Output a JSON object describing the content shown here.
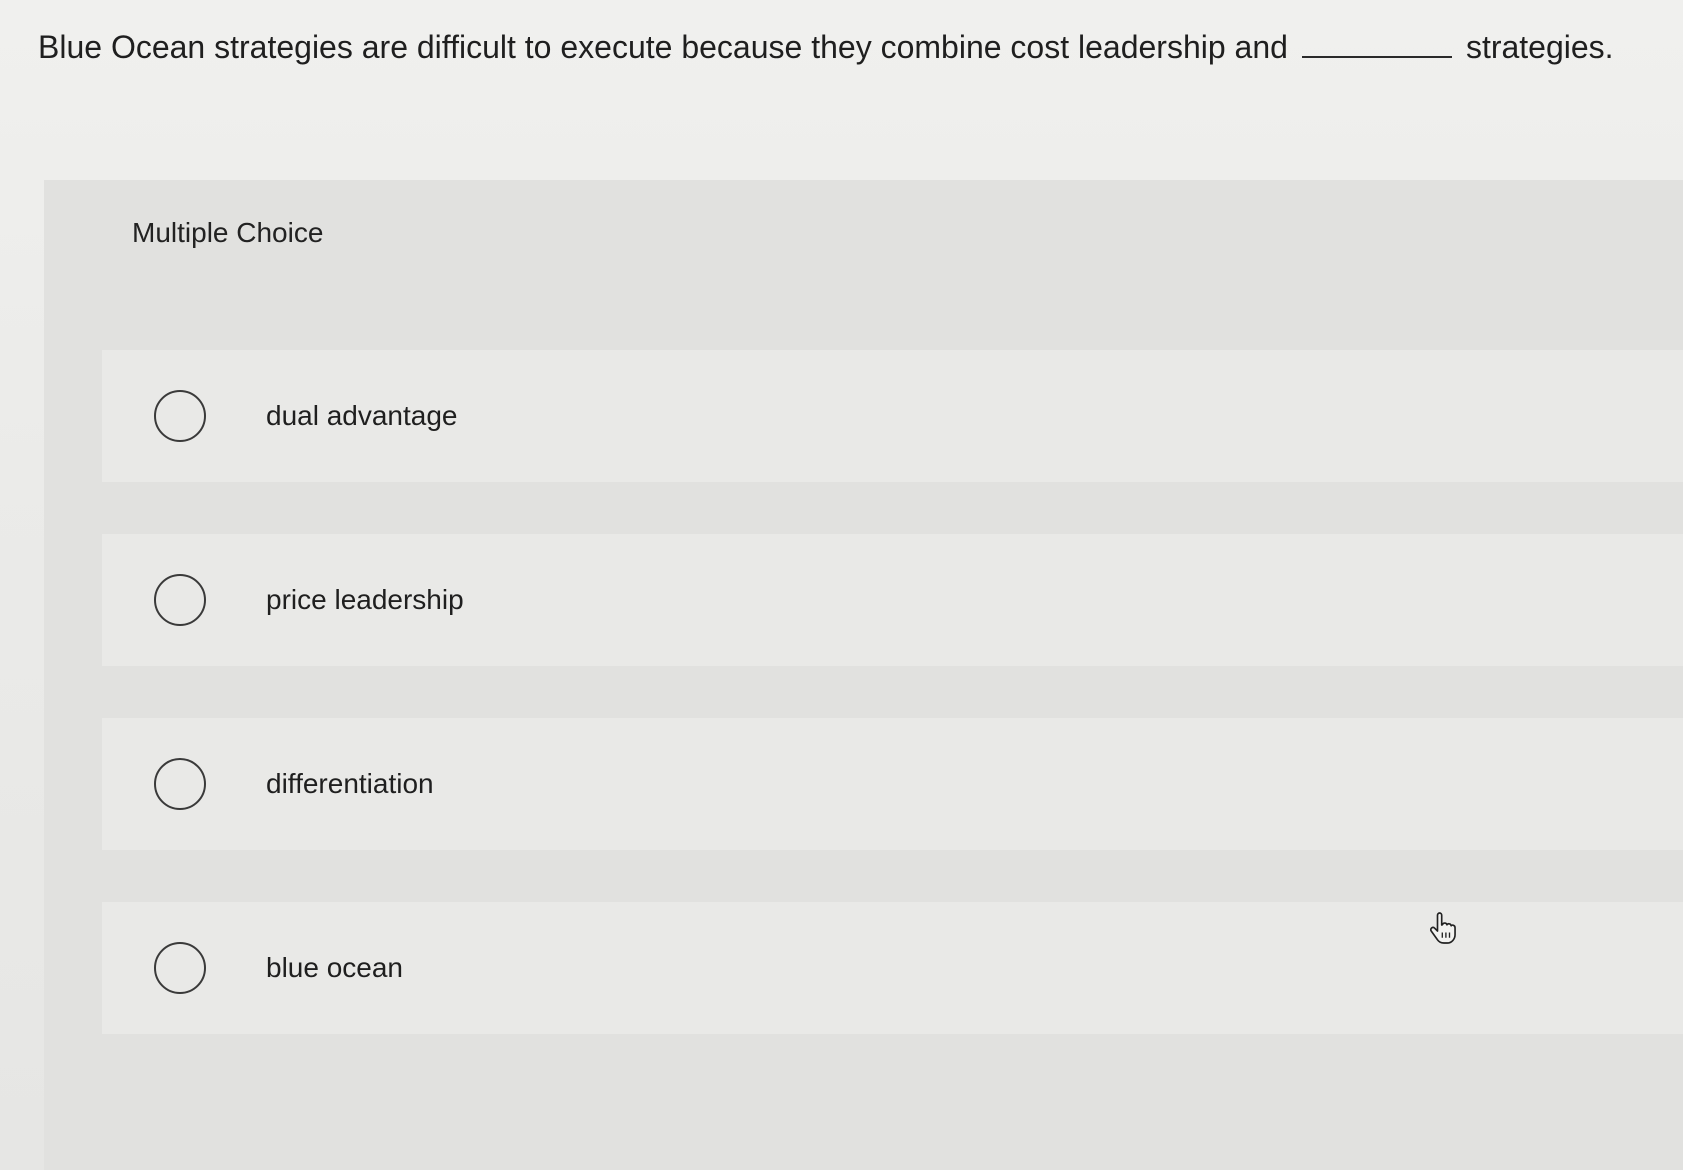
{
  "question": {
    "text_before": "Blue Ocean strategies are difficult to execute because they combine cost leadership and",
    "text_after": "strategies."
  },
  "multiple_choice": {
    "title": "Multiple Choice",
    "options": [
      {
        "label": "dual advantage"
      },
      {
        "label": "price leadership"
      },
      {
        "label": "differentiation"
      },
      {
        "label": "blue ocean"
      }
    ]
  },
  "icons": {
    "cursor": "hand-pointer-icon",
    "option_marker": "radio-circle-icon"
  }
}
